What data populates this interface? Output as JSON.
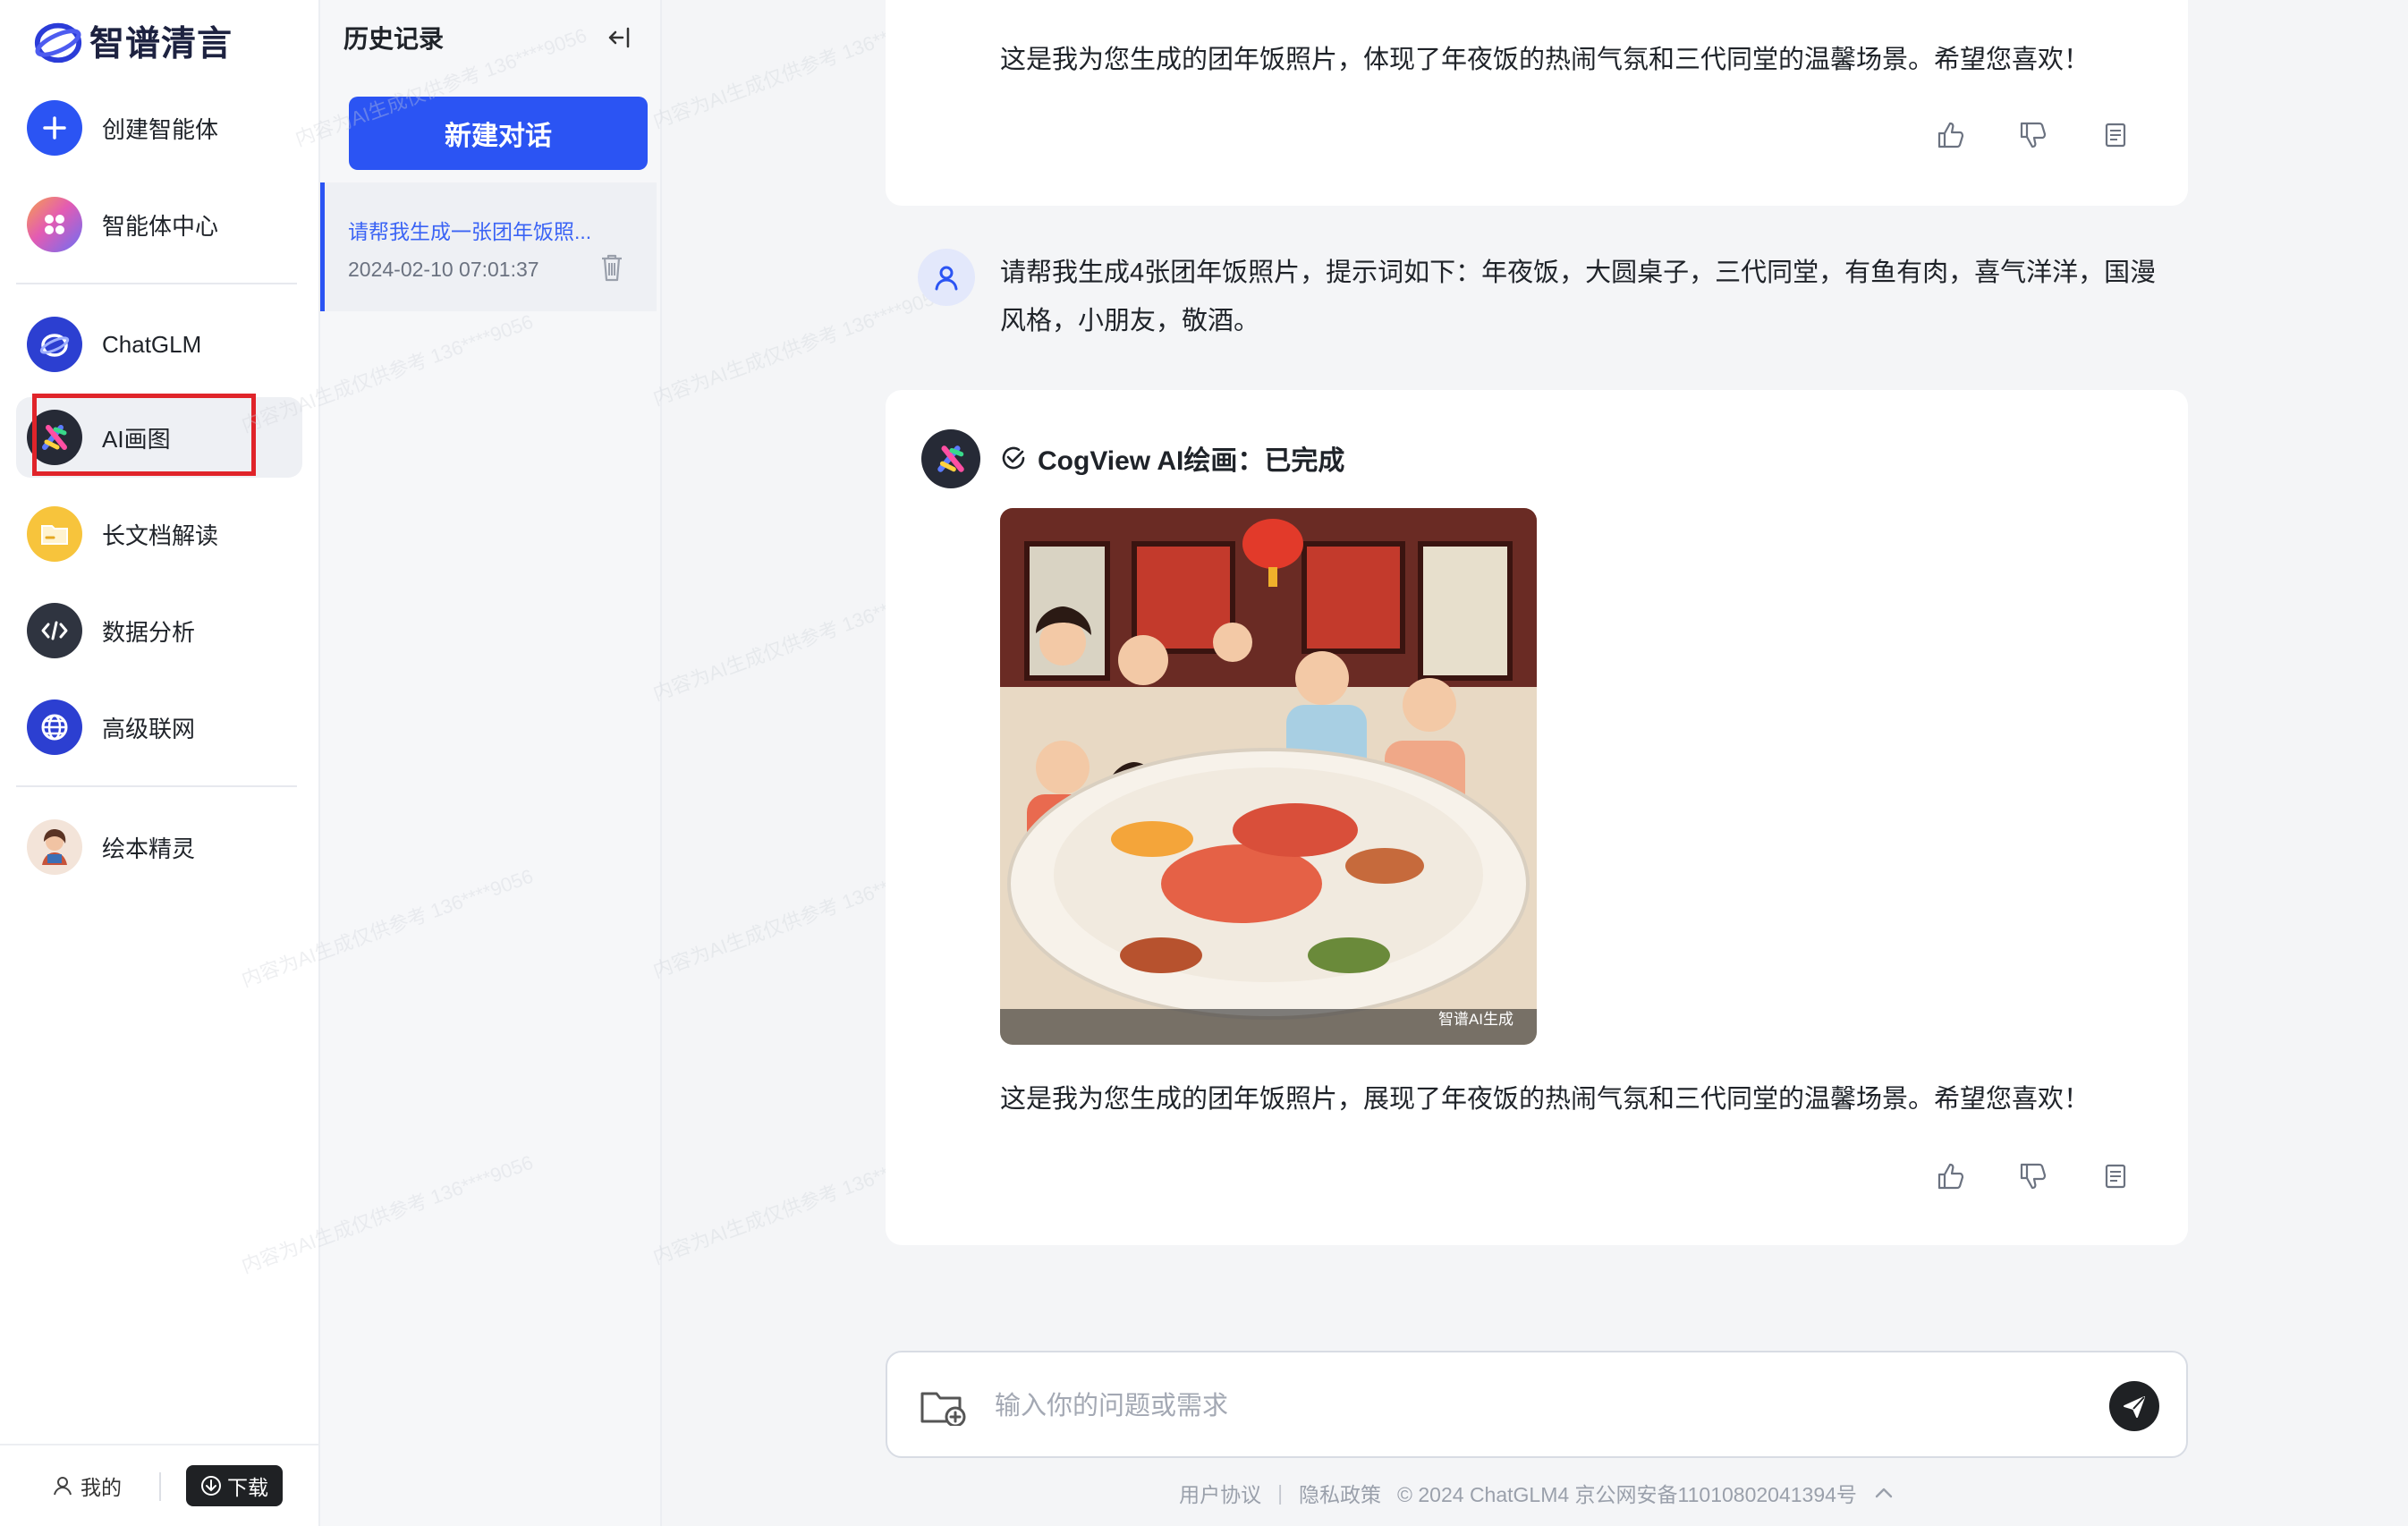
{
  "brand": {
    "name": "智谱清言"
  },
  "sidebar": {
    "items": [
      {
        "label": "创建智能体",
        "icon": "plus-icon"
      },
      {
        "label": "智能体中心",
        "icon": "apps-icon"
      },
      {
        "label": "ChatGLM",
        "icon": "chatglm-icon"
      },
      {
        "label": "AI画图",
        "icon": "ai-drawing-icon",
        "active": true
      },
      {
        "label": "长文档解读",
        "icon": "folder-icon"
      },
      {
        "label": "数据分析",
        "icon": "code-icon"
      },
      {
        "label": "高级联网",
        "icon": "globe-icon"
      },
      {
        "label": "绘本精灵",
        "icon": "picture-book-avatar"
      }
    ],
    "footer": {
      "me_label": "我的",
      "download_label": "下载"
    }
  },
  "history": {
    "title": "历史记录",
    "new_chat_label": "新建对话",
    "items": [
      {
        "title": "请帮我生成一张团年饭照...",
        "date": "2024-02-10 07:01:37"
      }
    ]
  },
  "chat": {
    "messages": [
      {
        "role": "assistant",
        "text": "这是我为您生成的团年饭照片，体现了年夜饭的热闹气氛和三代同堂的温馨场景。希望您喜欢！"
      },
      {
        "role": "user",
        "text": "请帮我生成4张团年饭照片，提示词如下：年夜饭，大圆桌子，三代同堂，有鱼有肉，喜气洋洋，国漫风格，小朋友，敬酒。"
      },
      {
        "role": "assistant",
        "status": "CogView AI绘画：已完成",
        "image_watermark": "智谱AI生成",
        "text": "这是我为您生成的团年饭照片，展现了年夜饭的热闹气氛和三代同堂的温馨场景。希望您喜欢！"
      }
    ],
    "input_placeholder": "输入你的问题或需求"
  },
  "footer": {
    "user_agreement": "用户协议",
    "privacy_policy": "隐私政策",
    "copyright": "© 2024 ChatGLM4 京公网安备11010802041394号"
  },
  "watermark_text": "内容为AI生成仅供参考 136****9056",
  "colors": {
    "accent": "#2b54f3",
    "highlight": "#e0242a"
  }
}
